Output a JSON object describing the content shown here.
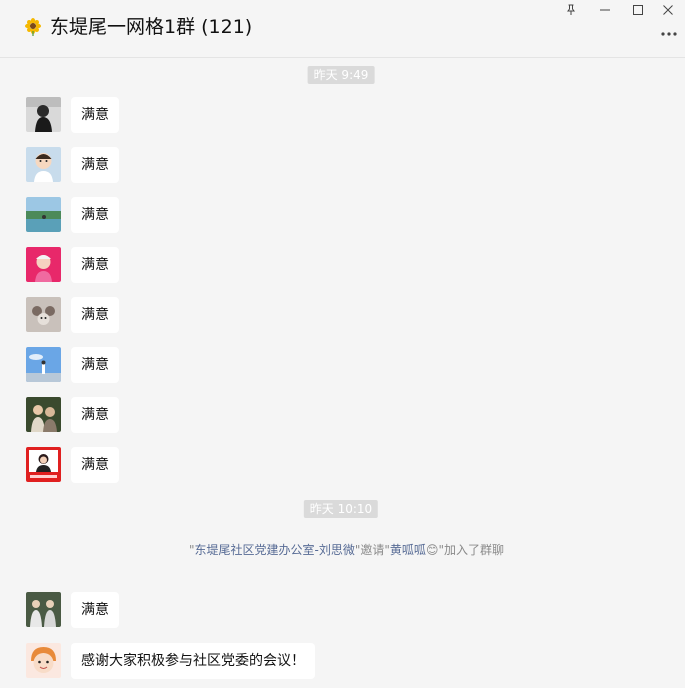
{
  "window": {
    "title": "东堤尾一网格1群 (121)",
    "title_icon": "sunflower-icon",
    "pin_icon": "pin-icon",
    "minimize_icon": "minimize-icon",
    "maximize_icon": "maximize-icon",
    "close_icon": "close-icon",
    "more_icon": "more-icon"
  },
  "chat": {
    "time1": "昨天 9:49",
    "time2": "昨天 10:10",
    "messages": [
      {
        "text": "满意"
      },
      {
        "text": "满意"
      },
      {
        "text": "满意"
      },
      {
        "text": "满意"
      },
      {
        "text": "满意"
      },
      {
        "text": "满意"
      },
      {
        "text": "满意"
      },
      {
        "text": "满意"
      }
    ],
    "system_notice": {
      "q1": "\"",
      "inviter": "东堤尾社区党建办公室-刘思微",
      "q2": "\"邀请\"",
      "invitee": "黄呱呱",
      "emoji": "😊",
      "tail": "\"加入了群聊"
    },
    "after": [
      {
        "text": "满意"
      },
      {
        "text": "感谢大家积极参与社区党委的会议！"
      }
    ]
  }
}
